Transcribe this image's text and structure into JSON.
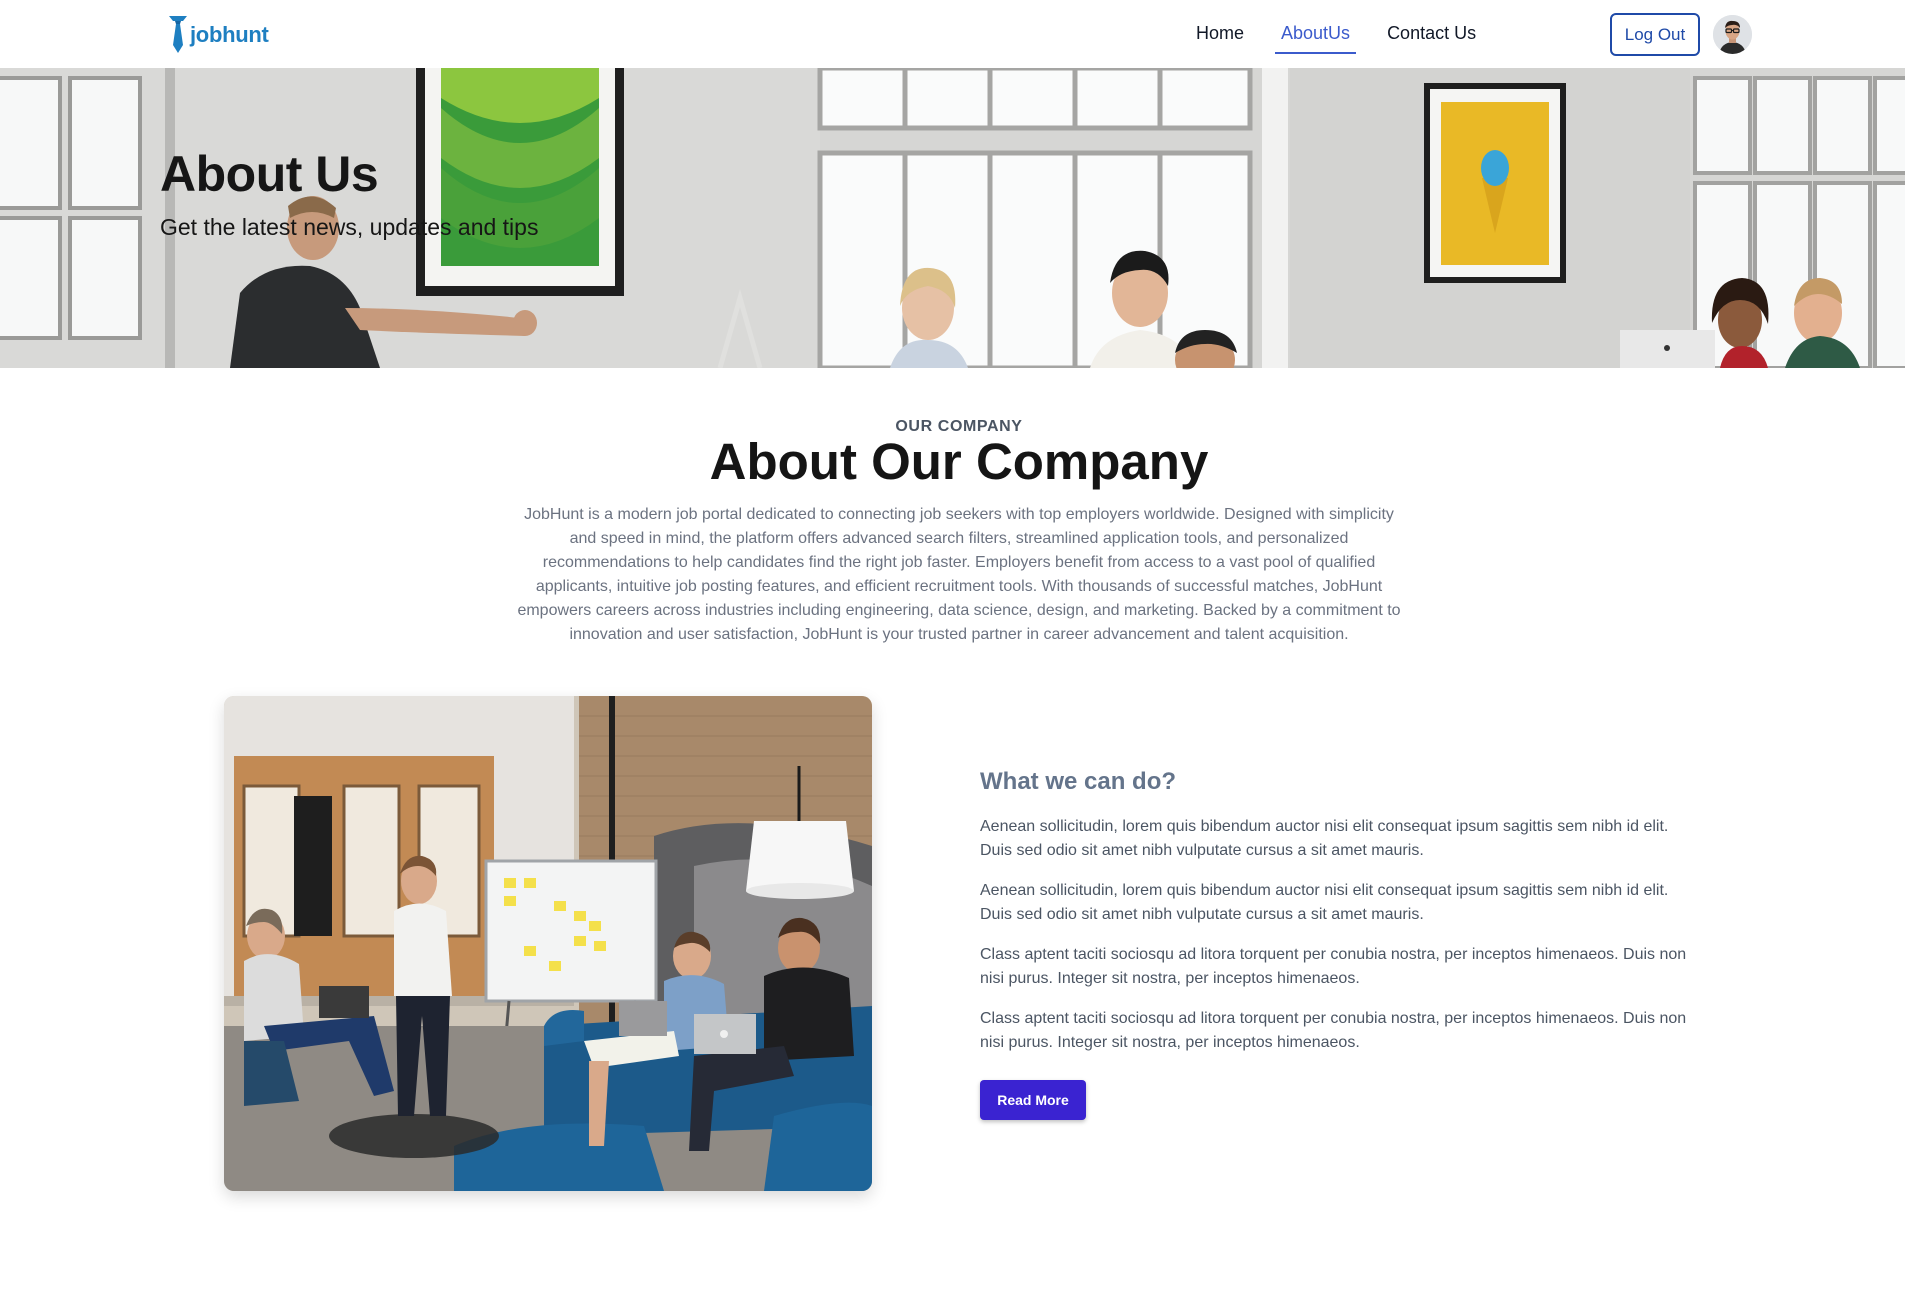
{
  "brand": {
    "name": "jobhunt",
    "color": "#1e7fc1"
  },
  "nav": {
    "items": [
      {
        "label": "Home",
        "active": false
      },
      {
        "label": "AboutUs",
        "active": true
      },
      {
        "label": "Contact Us",
        "active": false
      }
    ],
    "logout_label": "Log Out",
    "accent_color": "#3b5bcc"
  },
  "hero": {
    "title": "About Us",
    "subtitle": "Get the latest news, updates and tips"
  },
  "company": {
    "eyebrow": "OUR COMPANY",
    "title": "About Our Company",
    "description": "JobHunt is a modern job portal dedicated to connecting job seekers with top employers worldwide. Designed with simplicity and speed in mind, the platform offers advanced search filters, streamlined application tools, and personalized recommendations to help candidates find the right job faster. Employers benefit from access to a vast pool of qualified applicants, intuitive job posting features, and efficient recruitment tools. With thousands of successful matches, JobHunt empowers careers across industries including engineering, data science, design, and marketing. Backed by a commitment to innovation and user satisfaction, JobHunt is your trusted partner in career advancement and talent acquisition."
  },
  "feature": {
    "heading": "What we can do?",
    "paragraphs": [
      "Aenean sollicitudin, lorem quis bibendum auctor nisi elit consequat ipsum sagittis sem nibh id elit. Duis sed odio sit amet nibh vulputate cursus a sit amet mauris.",
      "Aenean sollicitudin, lorem quis bibendum auctor nisi elit consequat ipsum sagittis sem nibh id elit. Duis sed odio sit amet nibh vulputate cursus a sit amet mauris.",
      "Class aptent taciti sociosqu ad litora torquent per conubia nostra, per inceptos himenaeos. Duis non nisi purus. Integer sit nostra, per inceptos himenaeos.",
      "Class aptent taciti sociosqu ad litora torquent per conubia nostra, per inceptos himenaeos. Duis non nisi purus. Integer sit nostra, per inceptos himenaeos."
    ],
    "button_label": "Read More",
    "button_color": "#3a23d1"
  }
}
